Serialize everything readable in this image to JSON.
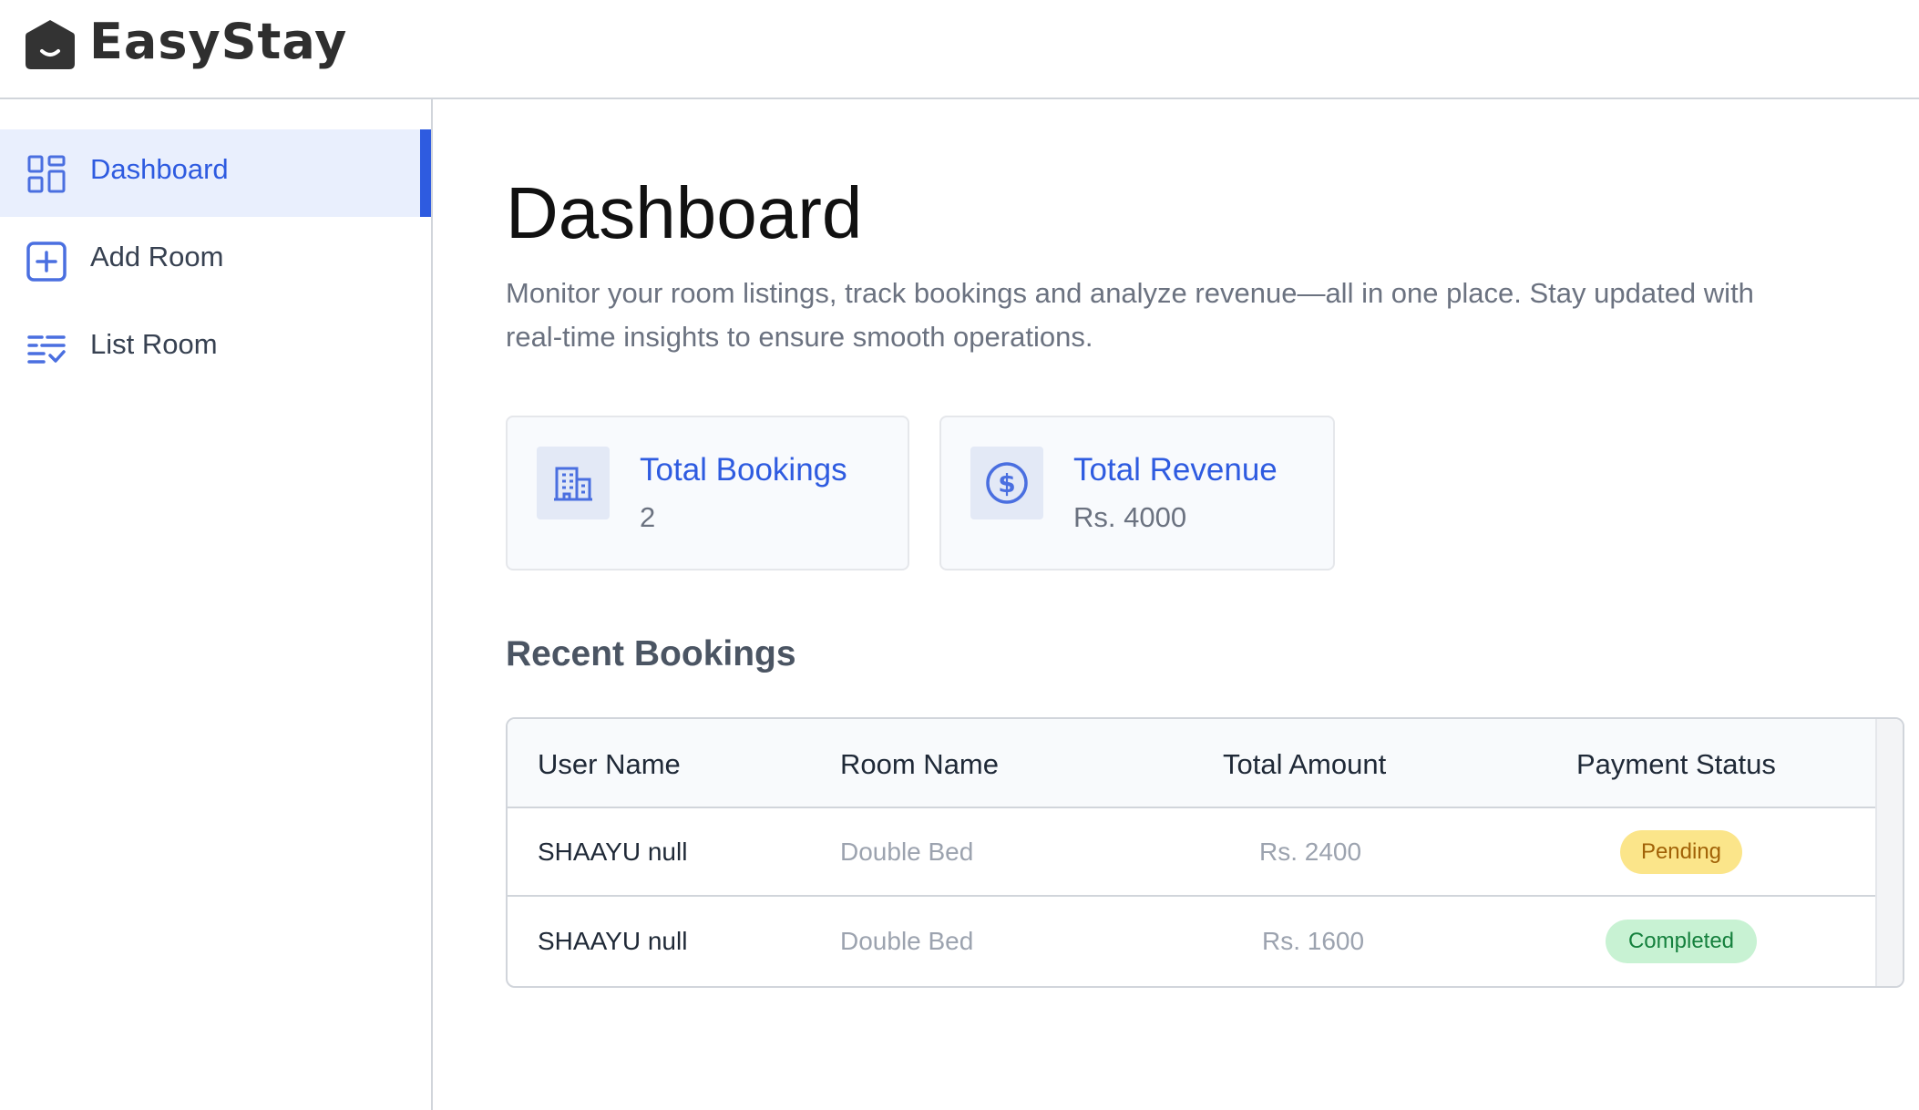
{
  "app": {
    "name": "EasyStay"
  },
  "sidebar": {
    "items": [
      {
        "label": "Dashboard",
        "icon": "dashboard-grid-icon",
        "active": true
      },
      {
        "label": "Add Room",
        "icon": "add-square-icon",
        "active": false
      },
      {
        "label": "List Room",
        "icon": "list-check-icon",
        "active": false
      }
    ]
  },
  "main": {
    "title": "Dashboard",
    "description": "Monitor your room listings, track bookings and analyze revenue—all in one place. Stay updated with real-time insights to ensure smooth operations.",
    "stats": [
      {
        "label": "Total Bookings",
        "value": "2",
        "icon": "building-icon"
      },
      {
        "label": "Total Revenue",
        "value": "Rs. 4000",
        "icon": "dollar-circle-icon"
      }
    ],
    "recent_title": "Recent Bookings",
    "table": {
      "headers": [
        "User Name",
        "Room Name",
        "Total Amount",
        "Payment Status"
      ],
      "rows": [
        {
          "user": "SHAAYU null",
          "room": "Double Bed",
          "amount": "Rs. 2400",
          "status": "Pending"
        },
        {
          "user": "SHAAYU null",
          "room": "Double Bed",
          "amount": "Rs. 1600",
          "status": "Completed"
        }
      ]
    }
  },
  "colors": {
    "accent": "#2e5be0",
    "active_bg": "#e9effd",
    "pending_bg": "#fbe58a",
    "completed_bg": "#c8f2d3"
  }
}
